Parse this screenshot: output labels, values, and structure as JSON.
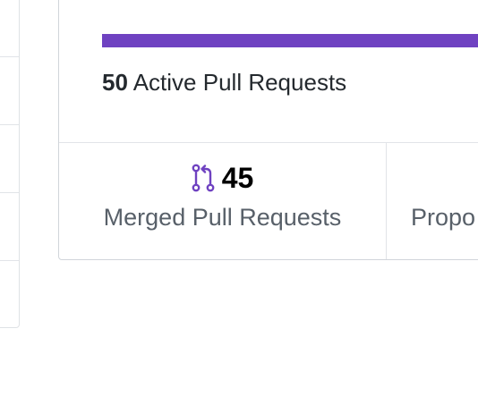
{
  "summary": {
    "active_count": "50",
    "active_label": "Active Pull Requests",
    "bar_fill_fraction": 1.0,
    "bar_color": "#6f42c1"
  },
  "stats": {
    "merged": {
      "icon": "git-merge-icon",
      "icon_color": "#6f42c1",
      "count": "45",
      "label": "Merged Pull Requests"
    },
    "proposed": {
      "label": "Propo"
    }
  }
}
